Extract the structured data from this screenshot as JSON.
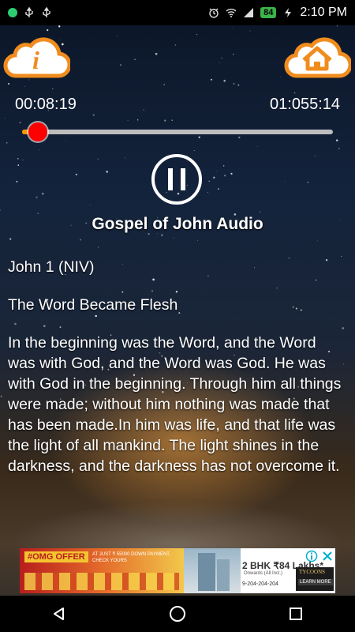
{
  "status_bar": {
    "time": "2:10 PM",
    "battery": "84",
    "icons": [
      "notification-dot-icon",
      "usb-icon",
      "usb-icon",
      "alarm-icon",
      "wifi-icon",
      "cellular-signal-icon",
      "battery-icon"
    ]
  },
  "header": {
    "info_icon": "info-cloud-icon",
    "home_icon": "home-cloud-icon",
    "info_letter": "i"
  },
  "player": {
    "elapsed": "00:08:19",
    "duration": "01:055:14",
    "progress_fraction": 0.05,
    "state_icon": "pause-icon",
    "title": "Gospel of John Audio"
  },
  "content": {
    "heading": "John 1 (NIV)",
    "subheading": "The Word Became Flesh",
    "text": "In the beginning was the Word, and the Word was with God, and the Word was God. He was with God in the beginning. Through him all things were made; without him nothing was made that has been made.In him was life, and that life was the light of all mankind. The light shines in the darkness, and the darkness has not overcome it."
  },
  "ad": {
    "left_label": "#OMG OFFER",
    "left_sub": "AT JUST ₹ 55000 DOWN PAYMENT, CHECK YOURS",
    "center_text": "2 BHK ₹84 Lakhs*",
    "center_sub": "Onwards (All Incl.)",
    "phone": "9-204-204-204",
    "brand": "TYCOONS",
    "cta": "LEARN MORE",
    "adchoices_icon": "adchoices-icon",
    "close_icon": "close-icon"
  },
  "nav_bar": {
    "back_icon": "back-icon",
    "home_icon": "home-circle-icon",
    "recents_icon": "recents-icon"
  }
}
